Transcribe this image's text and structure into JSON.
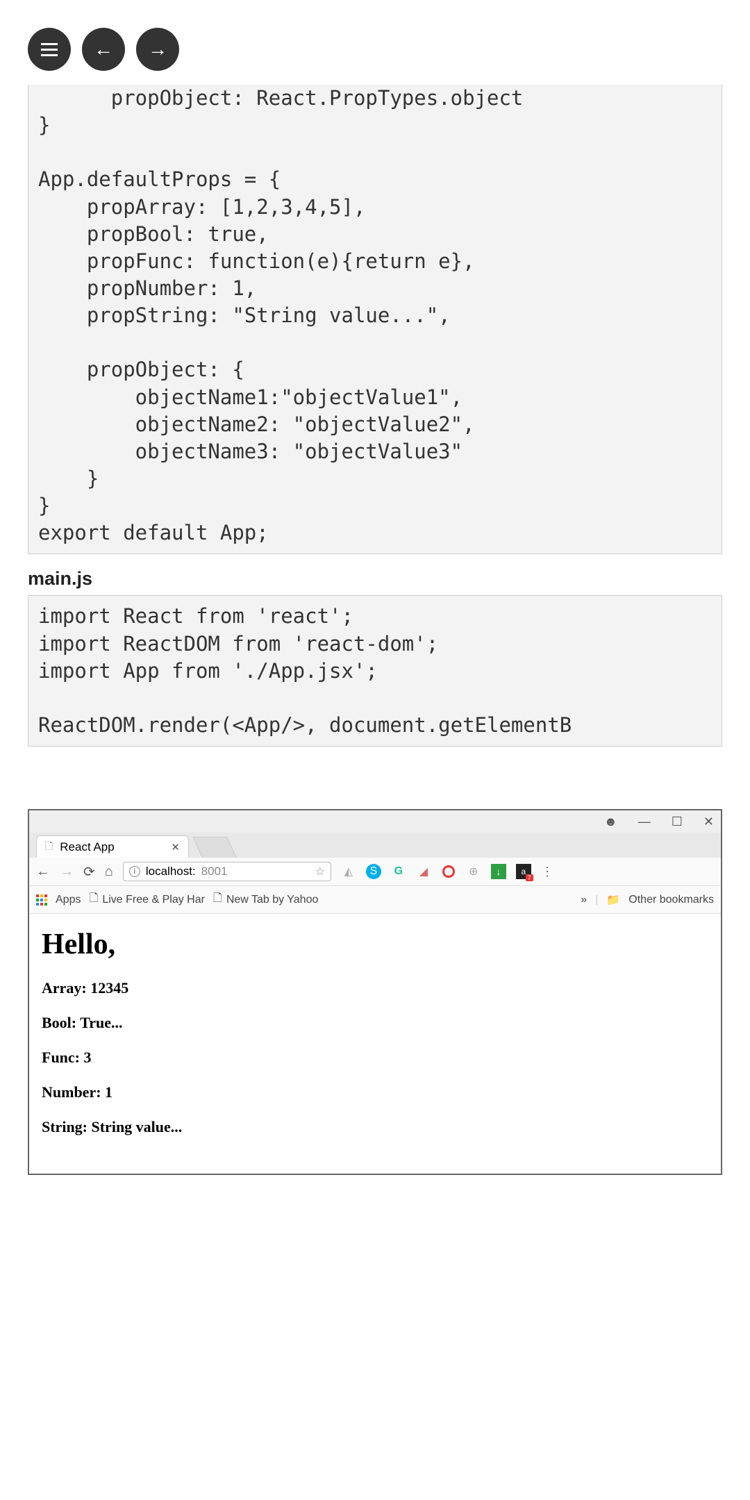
{
  "code1": "      propObject: React.PropTypes.object\n}\n\nApp.defaultProps = {\n    propArray: [1,2,3,4,5],\n    propBool: true,\n    propFunc: function(e){return e},\n    propNumber: 1,\n    propString: \"String value...\",\n\n    propObject: {\n        objectName1:\"objectValue1\",\n        objectName2: \"objectValue2\",\n        objectName3: \"objectValue3\"\n    }\n}\nexport default App;",
  "filename2": "main.js",
  "code2": "import React from 'react';\nimport ReactDOM from 'react-dom';\nimport App from './App.jsx';\n\nReactDOM.render(<App/>, document.getElementB",
  "browser": {
    "tabTitle": "React App",
    "addressPrefix": "localhost:",
    "addressPort": "8001",
    "appsLabel": "Apps",
    "bookmark1": "Live Free & Play Har",
    "bookmark2": "New Tab by Yahoo",
    "otherBookmarks": "Other bookmarks",
    "amazonBadge": "7"
  },
  "output": {
    "heading": "Hello,",
    "line1": "Array: 12345",
    "line2": "Bool: True...",
    "line3": "Func: 3",
    "line4": "Number: 1",
    "line5": "String: String value..."
  }
}
